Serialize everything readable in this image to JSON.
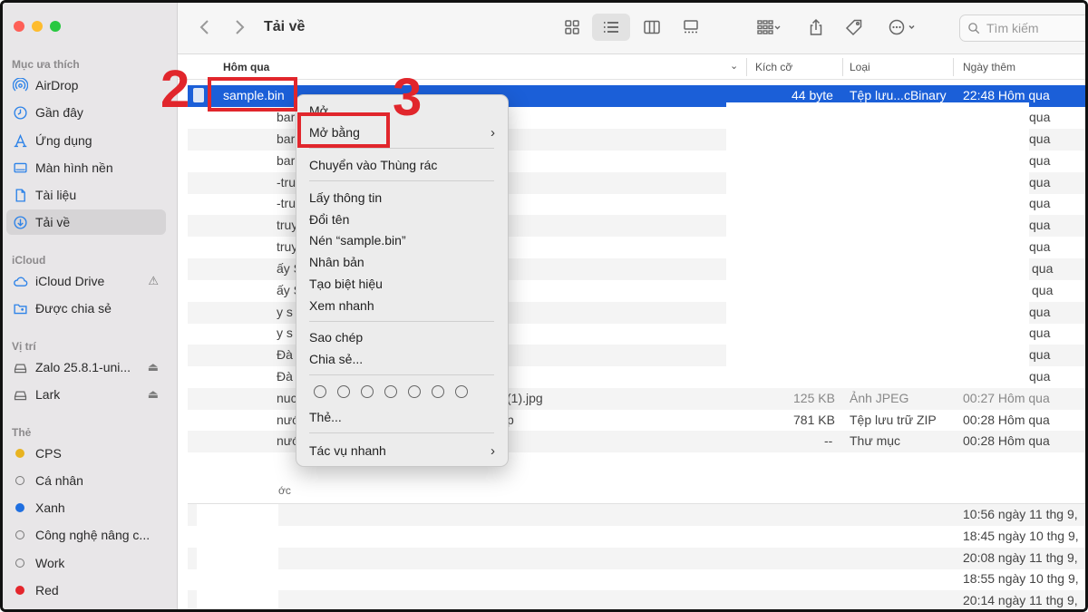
{
  "sidebar": {
    "sections": {
      "favorites": "Mục ưa thích",
      "icloud": "iCloud",
      "locations": "Vị trí",
      "tags": "Thẻ"
    },
    "favorites": [
      {
        "label": "AirDrop",
        "icon": "airdrop-icon"
      },
      {
        "label": "Gần đây",
        "icon": "clock-icon"
      },
      {
        "label": "Ứng dụng",
        "icon": "applications-icon"
      },
      {
        "label": "Màn hình nền",
        "icon": "desktop-icon"
      },
      {
        "label": "Tài liệu",
        "icon": "document-icon"
      },
      {
        "label": "Tải về",
        "icon": "download-icon"
      }
    ],
    "icloud": [
      {
        "label": "iCloud Drive",
        "icon": "cloud-icon"
      },
      {
        "label": "Được chia sẻ",
        "icon": "shared-folder-icon"
      }
    ],
    "locations": [
      {
        "label": "Zalo 25.8.1-uni...",
        "icon": "disk-icon"
      },
      {
        "label": "Lark",
        "icon": "disk-icon"
      }
    ],
    "tags": [
      {
        "label": "CPS",
        "color": "#e8b320"
      },
      {
        "label": "Cá nhân",
        "color": "none"
      },
      {
        "label": "Xanh",
        "color": "#1f6fe0"
      },
      {
        "label": "Công nghệ nâng c...",
        "color": "none"
      },
      {
        "label": "Work",
        "color": "none"
      },
      {
        "label": "Red",
        "color": "#e4262c"
      }
    ]
  },
  "toolbar": {
    "title": "Tải về",
    "search_placeholder": "Tìm kiếm"
  },
  "columns": {
    "name": "Hôm qua",
    "size": "Kích cỡ",
    "kind": "Loại",
    "date": "Ngày thêm"
  },
  "selected_row": {
    "name": "sample.bin",
    "size": "44 byte",
    "kind": "Tệp lưu...cBinary",
    "date": "22:48 Hôm qua"
  },
  "partial_rows": [
    {
      "name": "bar",
      "date": "qua"
    },
    {
      "name": "bar",
      "date": "qua"
    },
    {
      "name": "bar",
      "date": "qua"
    },
    {
      "name": "-tru",
      "date": "qua"
    },
    {
      "name": "-tru",
      "date": "qua"
    },
    {
      "name": "truy",
      "date": "qua"
    },
    {
      "name": "truy",
      "date": "qua"
    },
    {
      "name": "ấy S",
      "date": "qua"
    },
    {
      "name": "ấy S",
      "date": "qua"
    },
    {
      "name": "y s",
      "date": "qua"
    },
    {
      "name": "y s",
      "date": "qua"
    },
    {
      "name": "Đà",
      "date": "qua"
    },
    {
      "name": "Đà",
      "date": "qua"
    }
  ],
  "visible_rows": [
    {
      "name": "nuc",
      "name_end": "(1).jpg",
      "size": "125 KB",
      "kind": "Ảnh JPEG",
      "date": "00:27 Hôm qua"
    },
    {
      "name": "nướ",
      "name_end": "p",
      "size": "781 KB",
      "kind": "Tệp lưu trữ ZIP",
      "date": "00:28 Hôm qua"
    },
    {
      "name": "nướ",
      "name_end": "",
      "size": "--",
      "kind": "Thư mục",
      "date": "00:28 Hôm qua"
    }
  ],
  "earlier_section_label": "ớc",
  "earlier_dates": [
    "10:56 ngày 11 thg 9,",
    "18:45 ngày 10 thg 9,",
    "20:08 ngày 11 thg 9,",
    "18:55 ngày 10 thg 9,",
    "20:14 ngày 11 thg 9,"
  ],
  "context_menu": {
    "open": "Mở",
    "open_with": "Mở bằng",
    "move_to_trash": "Chuyển vào Thùng rác",
    "get_info": "Lấy thông tin",
    "rename": "Đổi tên",
    "compress": "Nén “sample.bin”",
    "duplicate": "Nhân bản",
    "make_alias": "Tạo biệt hiệu",
    "quick_look": "Xem nhanh",
    "copy": "Sao chép",
    "share": "Chia sẻ...",
    "tags": "Thẻ...",
    "quick_actions": "Tác vụ nhanh"
  },
  "annotations": {
    "step2": "2",
    "step3": "3",
    "color": "#e1262c"
  }
}
